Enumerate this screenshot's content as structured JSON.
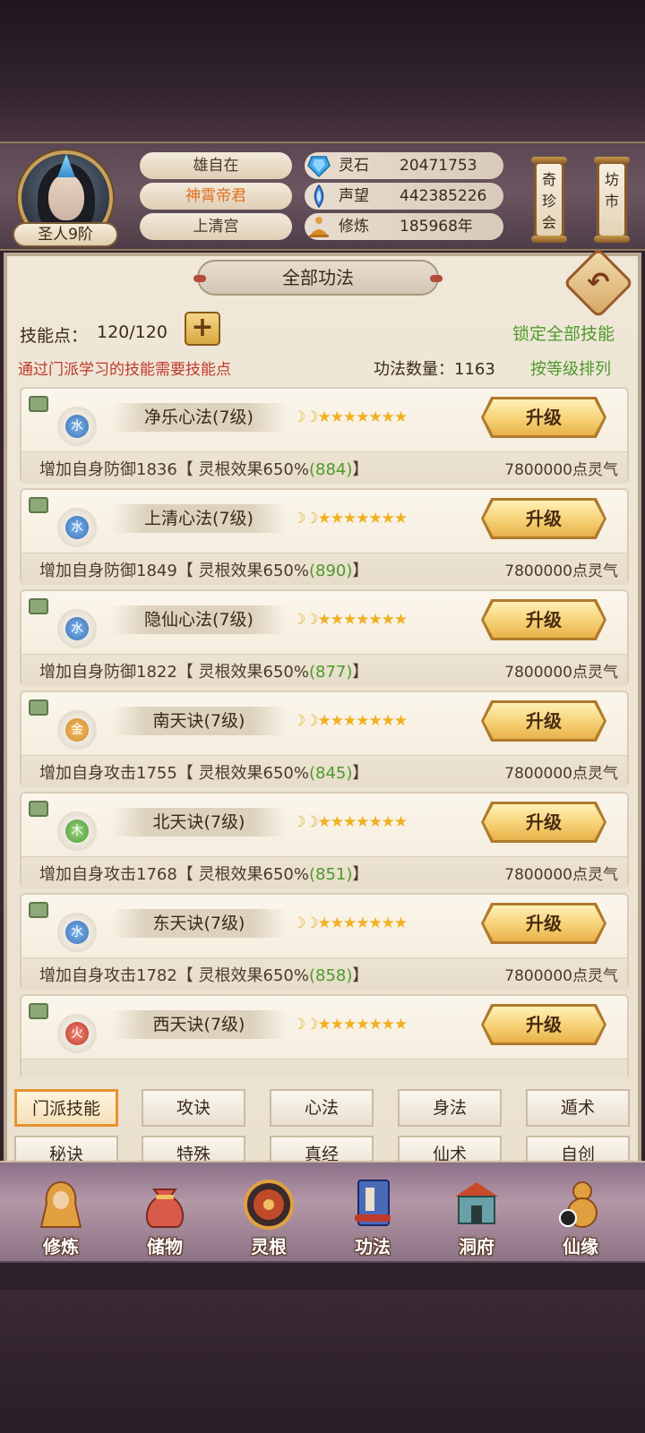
{
  "profile": {
    "rank": "圣人9阶",
    "name": "雄自在",
    "title": "神霄帝君",
    "sect": "上清宫",
    "resources": [
      {
        "label": "灵石",
        "value": "20471753",
        "icon": "spirit-stone-icon"
      },
      {
        "label": "声望",
        "value": "442385226",
        "icon": "reputation-icon"
      },
      {
        "label": "修炼",
        "value": "185968年",
        "icon": "meditation-icon"
      }
    ]
  },
  "shortcuts": [
    {
      "label": "奇珍会"
    },
    {
      "label": "坊市"
    }
  ],
  "panel": {
    "title": "全部功法",
    "skill_points_label": "技能点：",
    "skill_points": "120/120",
    "plus": "+",
    "lock_all": "锁定全部技能",
    "hint": "通过门派学习的技能需要技能点",
    "count_label": "功法数量：1163",
    "sort": "按等级排列",
    "back": "↶"
  },
  "skills": [
    {
      "element": "水",
      "element_type": "water",
      "name": "净乐心法(7级)",
      "moons": "☽☽",
      "stars": "★★★★★★★",
      "effect_prefix": "增加自身防御1836【 灵根效果650%",
      "effect_bonus": "(884)",
      "effect_suffix": "】",
      "cost": "7800000点灵气",
      "button": "升级"
    },
    {
      "element": "水",
      "element_type": "water",
      "name": "上清心法(7级)",
      "moons": "☽☽",
      "stars": "★★★★★★★",
      "effect_prefix": "增加自身防御1849【 灵根效果650%",
      "effect_bonus": "(890)",
      "effect_suffix": "】",
      "cost": "7800000点灵气",
      "button": "升级"
    },
    {
      "element": "水",
      "element_type": "water",
      "name": "隐仙心法(7级)",
      "moons": "☽☽",
      "stars": "★★★★★★★",
      "effect_prefix": "增加自身防御1822【 灵根效果650%",
      "effect_bonus": "(877)",
      "effect_suffix": "】",
      "cost": "7800000点灵气",
      "button": "升级"
    },
    {
      "element": "金",
      "element_type": "metal",
      "name": "南天诀(7级)",
      "moons": "☽☽",
      "stars": "★★★★★★★",
      "effect_prefix": "增加自身攻击1755【 灵根效果650%",
      "effect_bonus": "(845)",
      "effect_suffix": "】",
      "cost": "7800000点灵气",
      "button": "升级"
    },
    {
      "element": "木",
      "element_type": "wood",
      "name": "北天诀(7级)",
      "moons": "☽☽",
      "stars": "★★★★★★★",
      "effect_prefix": "增加自身攻击1768【 灵根效果650%",
      "effect_bonus": "(851)",
      "effect_suffix": "】",
      "cost": "7800000点灵气",
      "button": "升级"
    },
    {
      "element": "水",
      "element_type": "water",
      "name": "东天诀(7级)",
      "moons": "☽☽",
      "stars": "★★★★★★★",
      "effect_prefix": "增加自身攻击1782【 灵根效果650%",
      "effect_bonus": "(858)",
      "effect_suffix": "】",
      "cost": "7800000点灵气",
      "button": "升级"
    },
    {
      "element": "火",
      "element_type": "fire",
      "name": "西天诀(7级)",
      "moons": "☽☽",
      "stars": "★★★★★★★",
      "effect_prefix": "",
      "effect_bonus": "",
      "effect_suffix": "",
      "cost": "",
      "button": "升级"
    }
  ],
  "tabs": [
    {
      "label": "门派技能",
      "active": true
    },
    {
      "label": "攻诀"
    },
    {
      "label": "心法"
    },
    {
      "label": "身法"
    },
    {
      "label": "遁术"
    },
    {
      "label": "秘诀"
    },
    {
      "label": "特殊"
    },
    {
      "label": "真经"
    },
    {
      "label": "仙术"
    },
    {
      "label": "自创"
    }
  ],
  "nav": [
    {
      "label": "修炼",
      "icon": "monk-icon"
    },
    {
      "label": "储物",
      "icon": "pouch-icon"
    },
    {
      "label": "灵根",
      "icon": "spirit-root-icon"
    },
    {
      "label": "功法",
      "icon": "scripture-book-icon"
    },
    {
      "label": "洞府",
      "icon": "cave-mansion-icon"
    },
    {
      "label": "仙缘",
      "icon": "gourd-icon"
    }
  ]
}
